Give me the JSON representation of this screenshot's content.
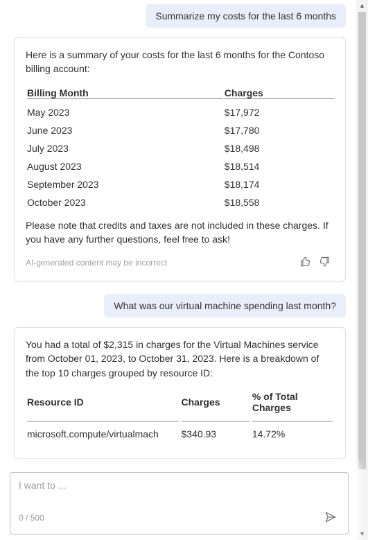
{
  "messages": {
    "user1": "Summarize my costs for the last 6 months",
    "assistant1": {
      "intro": "Here is a summary of your costs for the last 6 months for the Contoso billing account:",
      "table_headers": {
        "month": "Billing Month",
        "charges": "Charges"
      },
      "rows": [
        {
          "month": "May 2023",
          "charges": "$17,972"
        },
        {
          "month": "June 2023",
          "charges": "$17,780"
        },
        {
          "month": "July 2023",
          "charges": "$18,498"
        },
        {
          "month": "August 2023",
          "charges": "$18,514"
        },
        {
          "month": "September 2023",
          "charges": "$18,174"
        },
        {
          "month": "October 2023",
          "charges": "$18,558"
        }
      ],
      "footnote": "Please note that credits and taxes are not included in these charges. If you have any further questions, feel free to ask!"
    },
    "user2": "What was our virtual machine spending last month?",
    "assistant2": {
      "intro": "You had a total of $2,315 in charges for the Virtual Machines service from October 01, 2023, to October 31, 2023. Here is a breakdown of the top 10 charges grouped by resource ID:",
      "table_headers": {
        "resource": "Resource ID",
        "charges": "Charges",
        "pct": "% of Total Charges"
      },
      "rows": [
        {
          "resource": "microsoft.compute/virtualmach",
          "charges": "$340.93",
          "pct": "14.72%"
        }
      ]
    }
  },
  "disclaimer": "AI-generated content may be incorrect",
  "input": {
    "placeholder": "I want to ...",
    "counter": "0 / 500"
  }
}
